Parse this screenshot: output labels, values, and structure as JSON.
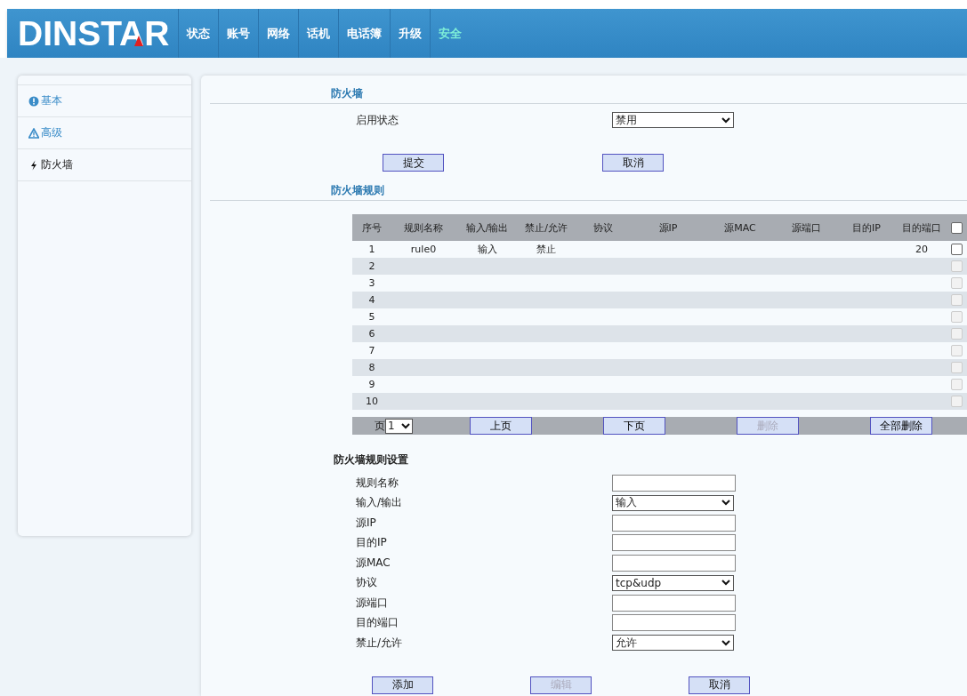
{
  "header": {
    "logo": "DINSTAR",
    "nav": [
      {
        "label": "状态",
        "selected": false
      },
      {
        "label": "账号",
        "selected": false
      },
      {
        "label": "网络",
        "selected": false
      },
      {
        "label": "话机",
        "selected": false
      },
      {
        "label": "电话簿",
        "selected": false
      },
      {
        "label": "升级",
        "selected": false
      },
      {
        "label": "安全",
        "selected": true
      }
    ]
  },
  "sidebar": {
    "items": [
      {
        "label": "基本",
        "kind": "info",
        "selected": false
      },
      {
        "label": "高级",
        "kind": "warning",
        "selected": false
      },
      {
        "label": "防火墙",
        "kind": "bolt",
        "selected": true
      }
    ]
  },
  "firewall": {
    "title": "防火墙",
    "status_label": "启用状态",
    "status_value": "禁用",
    "submit": "提交",
    "cancel": "取消"
  },
  "rules": {
    "title": "防火墙规则",
    "columns": [
      "序号",
      "规则名称",
      "输入/输出",
      "禁止/允许",
      "协议",
      "源IP",
      "源MAC",
      "源端口",
      "目的IP",
      "目的端口"
    ],
    "select_all_checked": false,
    "rows": [
      {
        "index": "1",
        "rule_name": "rule0",
        "direction": "输入",
        "action": "禁止",
        "dst_port": "20",
        "checked": false,
        "disabled": false
      },
      {
        "index": "2",
        "checked": false,
        "disabled": true
      },
      {
        "index": "3",
        "checked": false,
        "disabled": true
      },
      {
        "index": "4",
        "checked": false,
        "disabled": true
      },
      {
        "index": "5",
        "checked": false,
        "disabled": true
      },
      {
        "index": "6",
        "checked": false,
        "disabled": true
      },
      {
        "index": "7",
        "checked": false,
        "disabled": true
      },
      {
        "index": "8",
        "checked": false,
        "disabled": true
      },
      {
        "index": "9",
        "checked": false,
        "disabled": true
      },
      {
        "index": "10",
        "checked": false,
        "disabled": true
      }
    ],
    "pager": {
      "page_label": "页",
      "page": "1",
      "buttons": [
        {
          "label": "上页",
          "disabled": false
        },
        {
          "label": "下页",
          "disabled": false
        },
        {
          "label": "删除",
          "disabled": true
        },
        {
          "label": "全部删除",
          "disabled": false
        }
      ]
    }
  },
  "rule_settings": {
    "title": "防火墙规则设置",
    "fields": [
      {
        "label": "规则名称",
        "kind": "text"
      },
      {
        "label": "输入/输出",
        "kind": "select",
        "value": "输入"
      },
      {
        "label": "源IP",
        "kind": "text"
      },
      {
        "label": "目的IP",
        "kind": "text"
      },
      {
        "label": "源MAC",
        "kind": "text"
      },
      {
        "label": "协议",
        "kind": "select",
        "value": "tcp&udp"
      },
      {
        "label": "源端口",
        "kind": "text"
      },
      {
        "label": "目的端口",
        "kind": "text"
      },
      {
        "label": "禁止/允许",
        "kind": "select",
        "value": "允许"
      }
    ],
    "buttons": [
      {
        "label": "添加",
        "disabled": false
      },
      {
        "label": "编辑",
        "disabled": true
      },
      {
        "label": "取消",
        "disabled": false
      }
    ]
  }
}
